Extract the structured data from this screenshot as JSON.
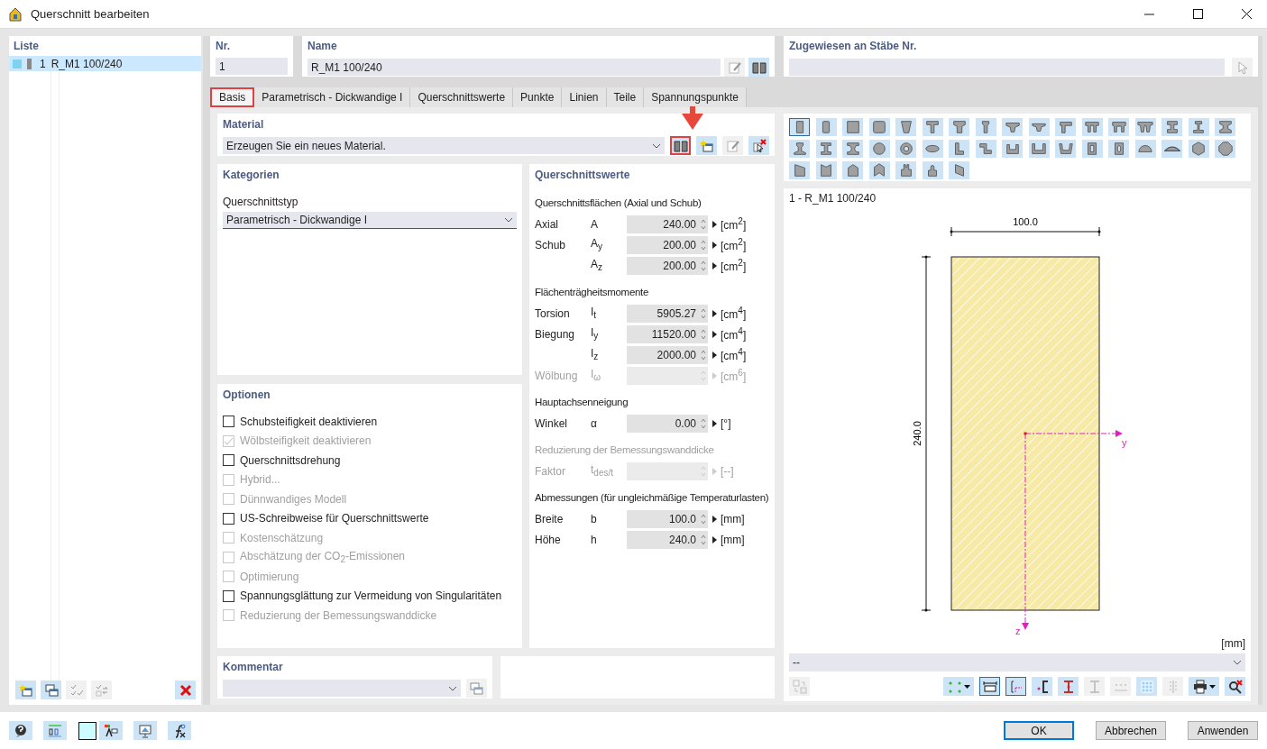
{
  "window": {
    "title": "Querschnitt bearbeiten"
  },
  "list": {
    "heading": "Liste",
    "items": [
      {
        "number": "1",
        "name": "R_M1 100/240",
        "selected": true
      }
    ],
    "tools": [
      {
        "kind": "new",
        "disabled": false
      },
      {
        "kind": "copy",
        "disabled": false
      },
      {
        "kind": "check",
        "disabled": true
      },
      {
        "kind": "renumber",
        "disabled": true
      },
      {
        "kind": "delete",
        "disabled": false
      }
    ]
  },
  "number": {
    "label": "Nr.",
    "value": "1"
  },
  "name": {
    "label": "Name",
    "value": "R_M1 100/240",
    "tools": [
      {
        "kind": "edit",
        "disabled": true
      },
      {
        "kind": "library",
        "disabled": false
      }
    ]
  },
  "assigned": {
    "label": "Zugewiesen an Stäbe Nr.",
    "tools": [
      {
        "kind": "pick",
        "disabled": true
      }
    ]
  },
  "tabs": [
    {
      "label": "Basis",
      "selected": true,
      "highlighted": true
    },
    {
      "label": "Parametrisch - Dickwandige I",
      "selected": false,
      "highlighted": false
    },
    {
      "label": "Querschnittswerte",
      "selected": false,
      "highlighted": false
    },
    {
      "label": "Punkte",
      "selected": false,
      "highlighted": false
    },
    {
      "label": "Linien",
      "selected": false,
      "highlighted": false
    },
    {
      "label": "Teile",
      "selected": false,
      "highlighted": false
    },
    {
      "label": "Spannungspunkte",
      "selected": false,
      "highlighted": false
    }
  ],
  "material": {
    "heading": "Material",
    "value": "Erzeugen Sie ein neues Material.",
    "tools": [
      {
        "kind": "library",
        "disabled": false,
        "highlighted": true
      },
      {
        "kind": "new",
        "disabled": false,
        "highlighted": false
      },
      {
        "kind": "edit",
        "disabled": true,
        "highlighted": false
      },
      {
        "kind": "delete-pick",
        "disabled": false,
        "highlighted": false
      }
    ]
  },
  "categories": {
    "heading": "Kategorien",
    "type_label": "Querschnittstyp",
    "type_value": "Parametrisch - Dickwandige I"
  },
  "options": {
    "heading": "Optionen",
    "items": [
      {
        "label": "Schubsteifigkeit deaktivieren",
        "checked": false,
        "disabled": false
      },
      {
        "label": "Wölbsteifigkeit deaktivieren",
        "checked": true,
        "disabled": true
      },
      {
        "label": "Querschnittsdrehung",
        "checked": false,
        "disabled": false
      },
      {
        "label": "Hybrid...",
        "checked": false,
        "disabled": true
      },
      {
        "label": "Dünnwandiges Modell",
        "checked": false,
        "disabled": true
      },
      {
        "label": "US-Schreibweise für Querschnittswerte",
        "checked": false,
        "disabled": false
      },
      {
        "label": "Kostenschätzung",
        "checked": false,
        "disabled": true
      },
      {
        "label": "Abschätzung der CO$_{2}$-Emissionen",
        "checked": false,
        "disabled": true
      },
      {
        "label": "Optimierung",
        "checked": false,
        "disabled": true
      },
      {
        "label": "Spannungsglättung zur Vermeidung von Singularitäten",
        "checked": false,
        "disabled": false
      },
      {
        "label": "Reduzierung der Bemessungswanddicke",
        "checked": false,
        "disabled": true
      }
    ]
  },
  "properties": {
    "heading": "Querschnittswerte",
    "groups": [
      {
        "heading": "Querschnittsflächen (Axial und Schub)",
        "disabled": false,
        "rows": [
          {
            "label": "Axial",
            "symbol": "A",
            "value": "240.00",
            "unit": "[cm$^{2}$]",
            "disabled": false
          },
          {
            "label": "Schub",
            "symbol": "A$_{y}$",
            "value": "200.00",
            "unit": "[cm$^{2}$]",
            "disabled": false
          },
          {
            "symbol": "A$_{z}$",
            "value": "200.00",
            "unit": "[cm$^{2}$]",
            "disabled": false
          }
        ]
      },
      {
        "heading": "Flächenträgheitsmomente",
        "disabled": false,
        "rows": [
          {
            "label": "Torsion",
            "symbol": "I$_{t}$",
            "value": "5905.27",
            "unit": "[cm$^{4}$]",
            "disabled": false
          },
          {
            "label": "Biegung",
            "symbol": "I$_{y}$",
            "value": "11520.00",
            "unit": "[cm$^{4}$]",
            "disabled": false
          },
          {
            "symbol": "I$_{z}$",
            "value": "2000.00",
            "unit": "[cm$^{4}$]",
            "disabled": false
          },
          {
            "label": "Wölbung",
            "symbol": "I$_{ω}$",
            "unit": "[cm$^{6}$]",
            "disabled": true
          }
        ]
      },
      {
        "heading": "Hauptachsenneigung",
        "disabled": false,
        "rows": [
          {
            "label": "Winkel",
            "symbol": "α",
            "value": "0.00",
            "unit": "[°]",
            "disabled": false
          }
        ]
      },
      {
        "heading": "Reduzierung der Bemessungswanddicke",
        "disabled": true,
        "rows": [
          {
            "label": "Faktor",
            "symbol": "t$_{des/t}$",
            "unit": "[--]",
            "disabled": true
          }
        ]
      },
      {
        "heading": "Abmessungen (für ungleichmäßige Temperaturlasten)",
        "disabled": false,
        "rows": [
          {
            "label": "Breite",
            "symbol": "b",
            "value": "100.0",
            "unit": "[mm]",
            "disabled": false
          },
          {
            "label": "Höhe",
            "symbol": "h",
            "value": "240.0",
            "unit": "[mm]",
            "disabled": false
          }
        ]
      }
    ]
  },
  "comment": {
    "heading": "Kommentar",
    "tools": [
      {
        "kind": "copy",
        "disabled": true
      }
    ]
  },
  "shapes": [
    {
      "kind": "rect",
      "selected": true
    },
    {
      "kind": "rounded-rect",
      "selected": false
    },
    {
      "kind": "square",
      "selected": false
    },
    {
      "kind": "rounded-square",
      "selected": false
    },
    {
      "kind": "trapezoid",
      "selected": false
    },
    {
      "kind": "tee",
      "selected": false
    },
    {
      "kind": "tee-haunched",
      "selected": false
    },
    {
      "kind": "tee-slim",
      "selected": false
    },
    {
      "kind": "tee-tapered",
      "selected": false
    },
    {
      "kind": "tee-flat",
      "selected": false
    },
    {
      "kind": "tee-offset",
      "selected": false
    },
    {
      "kind": "double-tee",
      "selected": false
    },
    {
      "kind": "double-tee-tapered",
      "selected": false
    },
    {
      "kind": "double-tee-wide",
      "selected": false
    },
    {
      "kind": "i-beam",
      "selected": false
    },
    {
      "kind": "i-beam-asym",
      "selected": false
    },
    {
      "kind": "i-beam-tapered",
      "selected": false
    },
    {
      "kind": "i-tapered-asym",
      "selected": false
    },
    {
      "kind": "i-parallel",
      "selected": false
    },
    {
      "kind": "i-taper-web",
      "selected": false
    },
    {
      "kind": "circle",
      "selected": false
    },
    {
      "kind": "ring",
      "selected": false
    },
    {
      "kind": "ellipse",
      "selected": false
    },
    {
      "kind": "angle",
      "selected": false
    },
    {
      "kind": "z-section",
      "selected": false
    },
    {
      "kind": "channel",
      "selected": false
    },
    {
      "kind": "channel-wide",
      "selected": false
    },
    {
      "kind": "channel-tapered",
      "selected": false
    },
    {
      "kind": "box",
      "selected": false
    },
    {
      "kind": "box-rounded",
      "selected": false
    },
    {
      "kind": "half-circle",
      "selected": false
    },
    {
      "kind": "segment",
      "selected": false
    },
    {
      "kind": "hexagon",
      "selected": false
    },
    {
      "kind": "octagon",
      "selected": false
    },
    {
      "kind": "chamfer",
      "selected": false
    },
    {
      "kind": "notch",
      "selected": false
    },
    {
      "kind": "pointed",
      "selected": false
    },
    {
      "kind": "chevron",
      "selected": false
    },
    {
      "kind": "stepped",
      "selected": false
    },
    {
      "kind": "stepped-round",
      "selected": false
    },
    {
      "kind": "parallelogram",
      "selected": false
    }
  ],
  "diagram": {
    "title": "1 - R_M1 100/240",
    "width_label": "100.0",
    "height_label": "240.0",
    "axis_y": "y",
    "axis_z": "z",
    "unit": "[mm]",
    "view_value": "--",
    "left_tools": [
      {
        "kind": "transform",
        "pressed": false,
        "disabled": true,
        "dropdown": false
      }
    ],
    "tools": [
      {
        "kind": "points",
        "pressed": false,
        "disabled": false,
        "dropdown": true
      },
      {
        "kind": "dimensions",
        "pressed": true,
        "disabled": false,
        "dropdown": false
      },
      {
        "kind": "axes",
        "pressed": true,
        "disabled": false,
        "dropdown": false
      },
      {
        "kind": "shear-center",
        "pressed": false,
        "disabled": false,
        "dropdown": false
      },
      {
        "kind": "ibeam-red",
        "pressed": false,
        "disabled": false,
        "dropdown": false
      },
      {
        "kind": "ibeam",
        "pressed": false,
        "disabled": true,
        "dropdown": false
      },
      {
        "kind": "numbering",
        "pressed": false,
        "disabled": true,
        "dropdown": false
      },
      {
        "kind": "grid",
        "pressed": false,
        "disabled": false,
        "dropdown": false
      },
      {
        "kind": "list",
        "pressed": false,
        "disabled": true,
        "dropdown": false
      },
      {
        "kind": "print",
        "pressed": false,
        "disabled": false,
        "dropdown": true
      },
      {
        "kind": "zoom-reset",
        "pressed": false,
        "disabled": false,
        "dropdown": false
      }
    ]
  },
  "footer": {
    "tools": [
      {
        "kind": "help"
      },
      {
        "kind": "decimals"
      },
      {
        "kind": "swatch"
      },
      {
        "kind": "text-color"
      },
      {
        "kind": "view"
      },
      {
        "kind": "formula"
      }
    ],
    "buttons": [
      {
        "label": "OK",
        "default": true
      },
      {
        "label": "Abbrechen",
        "default": false
      },
      {
        "label": "Anwenden",
        "default": false
      }
    ]
  }
}
